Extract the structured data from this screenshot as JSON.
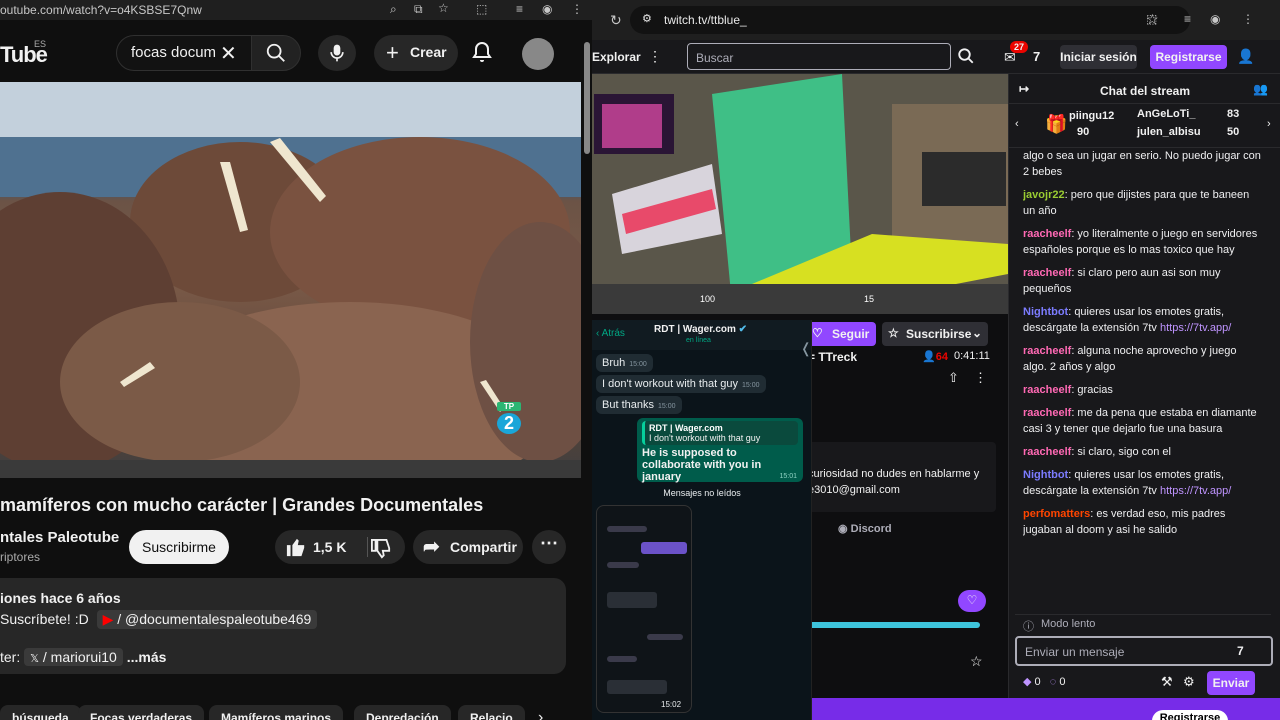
{
  "youtube": {
    "url": "outube.com/watch?v=o4KSBSE7Qnw",
    "logo": "Tube",
    "region": "ES",
    "search_value": "focas docum",
    "create_label": "Crear",
    "video_badge": "2",
    "title": "mamíferos con mucho carácter | Grandes Documentales",
    "channel": "ntales Paleotube",
    "subscribers": "riptores",
    "subscribe_label": "Suscribirme",
    "likes": "1,5 K",
    "share_label": "Compartir",
    "desc_line1": "iones  hace 6 años",
    "desc_line2_a": "Suscríbete! :D",
    "desc_line2_b": "/ @documentalespaleotube469",
    "desc_line3_a": "ter:",
    "desc_line3_b": "/ mariorui10",
    "desc_more": "...más",
    "chips": [
      "búsqueda",
      "Focas verdaderas",
      "Mamíferos marinos",
      "Depredación",
      "Relacio"
    ]
  },
  "twitch": {
    "url": "twitch.tv/ttblue_",
    "explore": "Explorar",
    "search_placeholder": "Buscar",
    "notif_count": "27",
    "login_label": "Iniciar sesión",
    "register_label": "Registrarse",
    "follow_label": "Seguir",
    "subscribe_label": "Suscribirse",
    "streamer": "= TTreck",
    "viewers": "64",
    "uptime": "0:41:11",
    "about_line1": "curiosidad no dudes en hablarme y",
    "about_line2": "e3010@gmail.com",
    "discord_label": "Discord",
    "chat_title": "Chat del stream",
    "gifts": [
      {
        "name": "piingu12",
        "count": "90"
      },
      {
        "name": "AnGeLoTi_",
        "count": "83"
      },
      {
        "name": "julen_albisu",
        "count": "50"
      }
    ],
    "messages": [
      {
        "user": "",
        "text": "algo o sea un jugar en serio. No puedo jugar con 2 bebes",
        "color": "#efeff1"
      },
      {
        "user": "javojr22",
        "text": ": pero que dijistes para que te baneen un año",
        "color": "#9acd32"
      },
      {
        "user": "raacheelf",
        "text": ": yo literalmente o juego en servidores españoles porque es lo mas toxico que hay",
        "color": "#ff69b4"
      },
      {
        "user": "raacheelf",
        "text": ": si claro pero aun asi son muy pequeños",
        "color": "#ff69b4"
      },
      {
        "user": "Nightbot",
        "text": ": quieres usar los emotes gratis, descárgate la extensión 7tv ",
        "link": "https://7tv.app/",
        "color": "#7c7cff"
      },
      {
        "user": "raacheelf",
        "text": ": alguna noche aprovecho y juego algo. 2 años y algo",
        "color": "#ff69b4"
      },
      {
        "user": "raacheelf",
        "text": ": gracias",
        "color": "#ff69b4"
      },
      {
        "user": "raacheelf",
        "text": ": me da pena que estaba en diamante casi 3 y tener que dejarlo fue una basura",
        "color": "#ff69b4"
      },
      {
        "user": "raacheelf",
        "text": ": si claro, sigo con el",
        "color": "#ff69b4"
      },
      {
        "user": "Nightbot",
        "text": ": quieres usar los emotes gratis, descárgate la extensión 7tv ",
        "link": "https://7tv.app/",
        "color": "#7c7cff"
      },
      {
        "user": "perfomatters",
        "text": ": es verdad eso, mis padres jugaban al doom y asi he salido",
        "color": "#ff4500"
      }
    ],
    "slow_mode": "Modo lento",
    "input_placeholder": "Enviar un mensaje",
    "points_a": "0",
    "points_b": "0",
    "send_label": "Enviar",
    "banner_button": "Registrarse"
  },
  "whatsapp": {
    "back_label": "Atrás",
    "contact": "RDT | Wager.com",
    "status": "en línea",
    "bubbles": [
      {
        "text": "Bruh",
        "time": "15:00"
      },
      {
        "text": "I don't workout with that guy",
        "time": "15:00"
      },
      {
        "text": "But thanks",
        "time": "15:00"
      }
    ],
    "reply_quote_name": "RDT | Wager.com",
    "reply_quote_text": "I don't workout with that guy",
    "reply_text": "He is supposed to collaborate with you in january",
    "reply_time": "15:01",
    "unread_label": "Mensajes no leídos",
    "phone_time": "15:02"
  },
  "colors": {
    "twitch_purple": "#9147ff",
    "youtube_bg": "#0f0f0f",
    "whatsapp_green": "#005c4b"
  }
}
